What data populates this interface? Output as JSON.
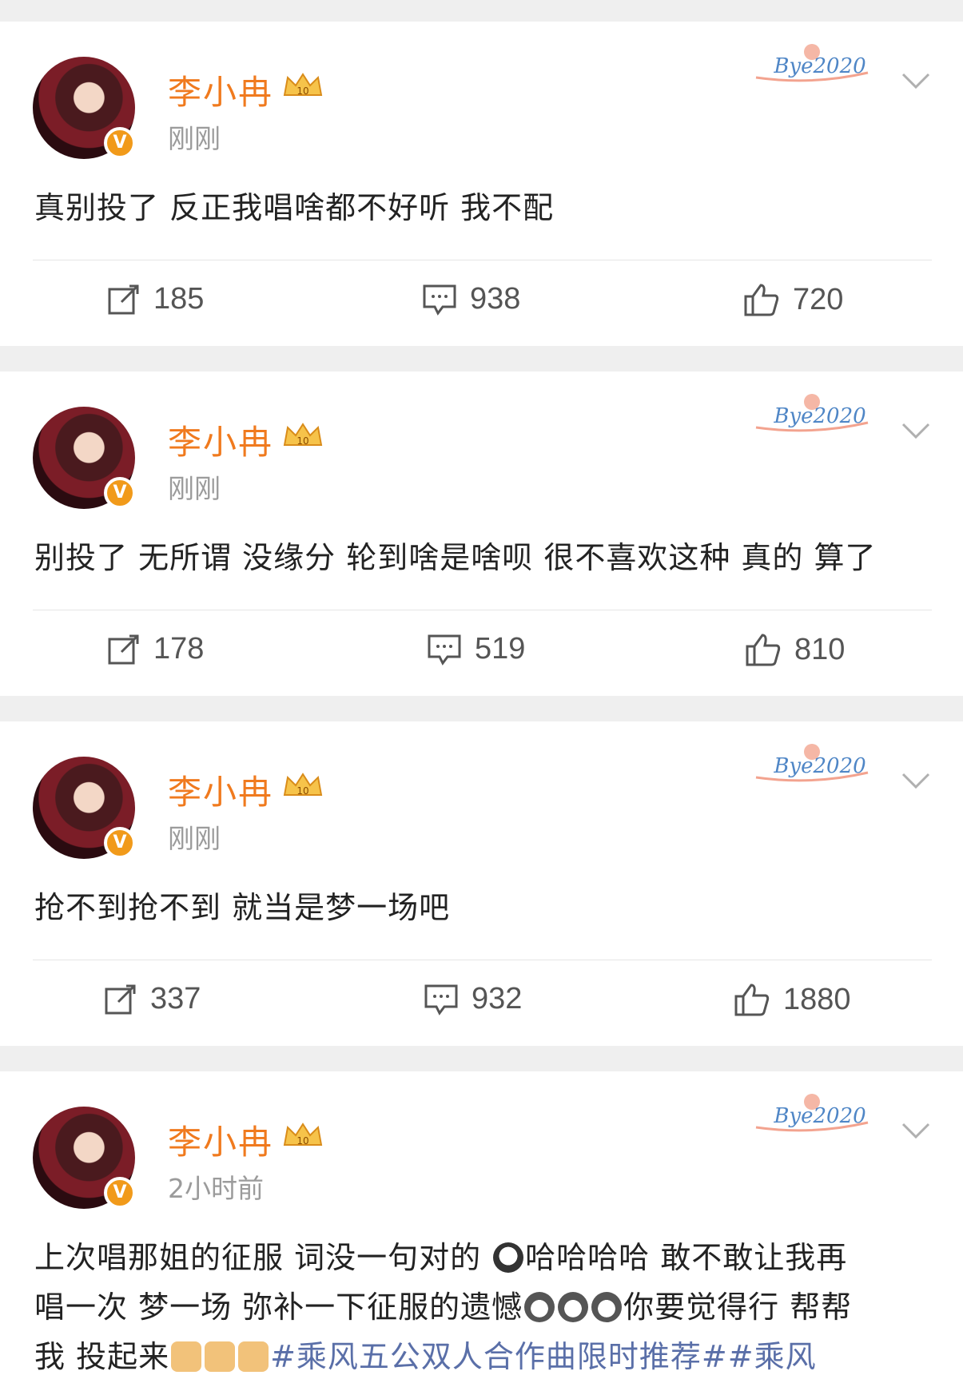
{
  "posts": [
    {
      "user": "李小冉",
      "time": "刚刚",
      "text": "真别投了 反正我唱啥都不好听 我不配",
      "repost": "185",
      "comments": "938",
      "likes": "720"
    },
    {
      "user": "李小冉",
      "time": "刚刚",
      "text": "别投了 无所谓 没缘分 轮到啥是啥呗 很不喜欢这种 真的  算了",
      "repost": "178",
      "comments": "519",
      "likes": "810"
    },
    {
      "user": "李小冉",
      "time": "刚刚",
      "text": "抢不到抢不到 就当是梦一场吧",
      "repost": "337",
      "comments": "932",
      "likes": "1880"
    },
    {
      "user": "李小冉",
      "time": "2小时前",
      "text_line1_a": "上次唱那姐的征服 词没一句对的 ",
      "text_line1_b": "哈哈哈哈 敢不敢让我再",
      "text_line2_a": "唱一次 梦一场 弥补一下征服的遗憾",
      "text_line2_b": "你要觉得行 帮帮",
      "text_line3_a": "我 投起来",
      "hashtags": "#乘风五公双人合作曲限时推荐##乘风"
    }
  ],
  "badge_text": "Bye2020",
  "verified_mark": "V",
  "crown_level": "10",
  "colors": {
    "username": "#f07a1e",
    "hashtag": "#5a6fa8",
    "badge": "#f19a1a"
  }
}
